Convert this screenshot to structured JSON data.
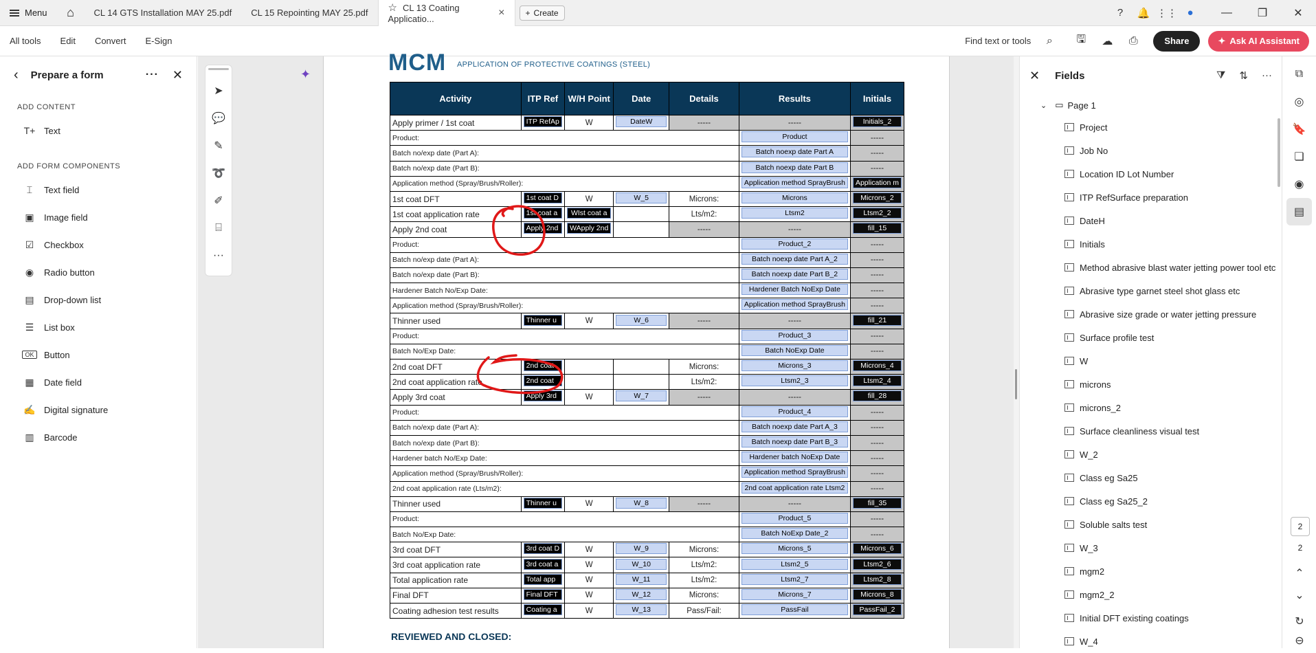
{
  "browser": {
    "menu_label": "Menu",
    "tabs": [
      {
        "label": "CL 14 GTS Installation MAY 25.pdf"
      },
      {
        "label": "CL 15 Repointing MAY 25.pdf"
      },
      {
        "label": "CL 13 Coating Applicatio..."
      }
    ],
    "create_label": "Create"
  },
  "toolbar": {
    "nav": [
      "All tools",
      "Edit",
      "Convert",
      "E-Sign"
    ],
    "find_label": "Find text or tools",
    "share_label": "Share",
    "ai_label": "Ask AI Assistant"
  },
  "left_panel": {
    "title": "Prepare a form",
    "section_content": "ADD CONTENT",
    "content_items": [
      {
        "label": "Text",
        "icon": "text-icon"
      }
    ],
    "section_components": "ADD FORM COMPONENTS",
    "component_items": [
      {
        "label": "Text field",
        "icon": "text-field-icon"
      },
      {
        "label": "Image field",
        "icon": "image-field-icon"
      },
      {
        "label": "Checkbox",
        "icon": "checkbox-icon"
      },
      {
        "label": "Radio button",
        "icon": "radio-button-icon"
      },
      {
        "label": "Drop-down list",
        "icon": "dropdown-icon"
      },
      {
        "label": "List box",
        "icon": "list-box-icon"
      },
      {
        "label": "Button",
        "icon": "button-icon"
      },
      {
        "label": "Date field",
        "icon": "date-field-icon"
      },
      {
        "label": "Digital signature",
        "icon": "signature-icon"
      },
      {
        "label": "Barcode",
        "icon": "barcode-icon"
      }
    ]
  },
  "document": {
    "logo": "MCM",
    "logo_subtitle": "APPLICATION OF PROTECTIVE COATINGS (STEEL)",
    "headers": [
      "Activity",
      "ITP Ref",
      "W/H Point",
      "Date",
      "Details",
      "Results",
      "Initials"
    ],
    "rows": [
      {
        "type": "main",
        "activity": "Apply primer / 1st coat",
        "itp": "ITP RefAp",
        "wh": "W",
        "date": "DateW",
        "details": "-----",
        "results": "-----",
        "initials": "Initials_2"
      },
      {
        "type": "sub",
        "activity": "Product:",
        "results": "Product",
        "initials": "-----"
      },
      {
        "type": "sub",
        "activity": "Batch no/exp date (Part A):",
        "results": "Batch noexp date Part A",
        "initials": "-----"
      },
      {
        "type": "sub",
        "activity": "Batch no/exp date (Part B):",
        "results": "Batch noexp date Part B",
        "initials": "-----"
      },
      {
        "type": "sub",
        "activity": "Application method (Spray/Brush/Roller):",
        "results": "Application method SprayBrush",
        "initials": "Application m"
      },
      {
        "type": "main",
        "activity": "1st coat DFT",
        "itp": "1st coat D",
        "wh": "W",
        "date": "W_5",
        "details": "Microns:",
        "results": "Microns",
        "initials": "Microns_2"
      },
      {
        "type": "main",
        "activity": "1st coat application rate",
        "itp": "1st coat a",
        "wh": "WIst coat a",
        "date": "",
        "details": "Lts/m2:",
        "results": "Ltsm2",
        "initials": "Ltsm2_2"
      },
      {
        "type": "main",
        "activity": "Apply 2nd coat",
        "itp": "Apply 2nd",
        "wh": "WApply 2nd",
        "date": "",
        "details": "-----",
        "results": "-----",
        "initials": "fill_15"
      },
      {
        "type": "sub",
        "activity": "Product:",
        "results": "Product_2",
        "initials": "-----"
      },
      {
        "type": "sub",
        "activity": "Batch no/exp date (Part A):",
        "results": "Batch noexp date Part A_2",
        "initials": "-----"
      },
      {
        "type": "sub",
        "activity": "Batch no/exp date (Part B):",
        "results": "Batch noexp date Part B_2",
        "initials": "-----"
      },
      {
        "type": "sub",
        "activity": "Hardener Batch No/Exp Date:",
        "results": "Hardener Batch NoExp Date",
        "initials": "-----"
      },
      {
        "type": "sub",
        "activity": "Application method (Spray/Brush/Roller):",
        "results": "Application method SprayBrush",
        "initials": "-----"
      },
      {
        "type": "main",
        "activity": "Thinner used",
        "itp": "Thinner u",
        "wh": "W",
        "date": "W_6",
        "details": "-----",
        "results": "-----",
        "initials": "fill_21"
      },
      {
        "type": "sub",
        "activity": "Product:",
        "results": "Product_3",
        "initials": "-----"
      },
      {
        "type": "sub",
        "activity": "Batch No/Exp Date:",
        "results": "Batch NoExp Date",
        "initials": "-----"
      },
      {
        "type": "main",
        "activity": "2nd coat DFT",
        "itp": "2nd coat",
        "wh": "",
        "date": "",
        "details": "Microns:",
        "results": "Microns_3",
        "initials": "Microns_4"
      },
      {
        "type": "main",
        "activity": "2nd coat application rate",
        "itp": "2nd coat",
        "wh": "",
        "date": "",
        "details": "Lts/m2:",
        "results": "Ltsm2_3",
        "initials": "Ltsm2_4"
      },
      {
        "type": "main",
        "activity": "Apply 3rd coat",
        "itp": "Apply 3rd",
        "wh": "W",
        "date": "W_7",
        "details": "-----",
        "results": "-----",
        "initials": "fill_28"
      },
      {
        "type": "sub",
        "activity": "Product:",
        "results": "Product_4",
        "initials": "-----"
      },
      {
        "type": "sub",
        "activity": "Batch no/exp date (Part A):",
        "results": "Batch noexp date Part A_3",
        "initials": "-----"
      },
      {
        "type": "sub",
        "activity": "Batch no/exp date (Part B):",
        "results": "Batch noexp date Part B_3",
        "initials": "-----"
      },
      {
        "type": "sub",
        "activity": "Hardener batch No/Exp Date:",
        "results": "Hardener batch NoExp Date",
        "initials": "-----"
      },
      {
        "type": "sub",
        "activity": "Application method (Spray/Brush/Roller):",
        "results": "Application method SprayBrush",
        "initials": "-----"
      },
      {
        "type": "sub",
        "activity": "2nd coat application rate (Lts/m2):",
        "results": "2nd coat application rate Ltsm2",
        "initials": "-----"
      },
      {
        "type": "main",
        "activity": "Thinner used",
        "itp": "Thinner u",
        "wh": "W",
        "date": "W_8",
        "details": "-----",
        "results": "-----",
        "initials": "fill_35"
      },
      {
        "type": "sub",
        "activity": "Product:",
        "results": "Product_5",
        "initials": "-----"
      },
      {
        "type": "sub",
        "activity": "Batch No/Exp Date:",
        "results": "Batch NoExp Date_2",
        "initials": "-----"
      },
      {
        "type": "main",
        "activity": "3rd coat DFT",
        "itp": "3rd coat D",
        "wh": "W",
        "date": "W_9",
        "details": "Microns:",
        "results": "Microns_5",
        "initials": "Microns_6"
      },
      {
        "type": "main",
        "activity": "3rd coat application rate",
        "itp": "3rd coat a",
        "wh": "W",
        "date": "W_10",
        "details": "Lts/m2:",
        "results": "Ltsm2_5",
        "initials": "Ltsm2_6"
      },
      {
        "type": "main",
        "activity": "Total application rate",
        "itp": "Total app",
        "wh": "W",
        "date": "W_11",
        "details": "Lts/m2:",
        "results": "Ltsm2_7",
        "initials": "Ltsm2_8"
      },
      {
        "type": "main",
        "activity": "Final DFT",
        "itp": "Final DFT",
        "wh": "W",
        "date": "W_12",
        "details": "Microns:",
        "results": "Microns_7",
        "initials": "Microns_8"
      },
      {
        "type": "main",
        "activity": "Coating adhesion test results",
        "itp": "Coating a",
        "wh": "W",
        "date": "W_13",
        "details": "Pass/Fail:",
        "results": "PassFail",
        "initials": "PassFail_2"
      }
    ],
    "reviewed": "REVIEWED AND CLOSED:"
  },
  "fields_panel": {
    "title": "Fields",
    "page_node": "Page 1",
    "items": [
      "Project",
      "Job No",
      "Location ID  Lot Number",
      "ITP RefSurface preparation",
      "DateH",
      "Initials",
      "Method abrasive blast water jetting power tool etc",
      "Abrasive type garnet steel shot glass etc",
      "Abrasive size  grade or water jetting pressure",
      "Surface profile test",
      "W",
      "microns",
      "microns_2",
      "Surface cleanliness visual test",
      "W_2",
      "Class eg Sa25",
      "Class eg Sa25_2",
      "Soluble salts test",
      "W_3",
      "mgm2",
      "mgm2_2",
      "Initial DFT existing coatings",
      "W_4"
    ]
  },
  "rail": {
    "page_current": "2",
    "page_total": "2"
  },
  "colors": {
    "header_navy": "#0a3757",
    "ai_button": "#e8495f",
    "ink_red": "#e01818"
  }
}
